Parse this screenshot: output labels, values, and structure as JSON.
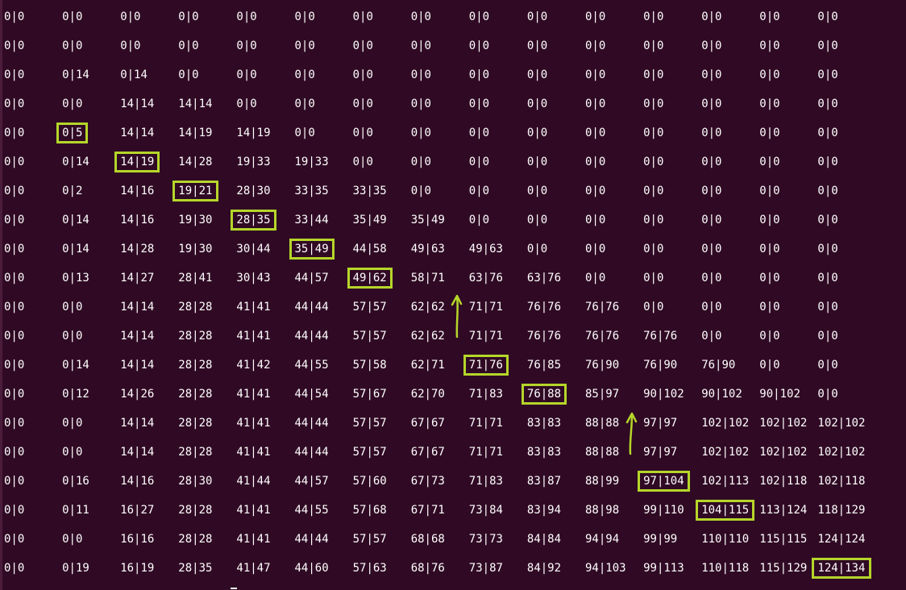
{
  "grid": {
    "rows": [
      [
        "0|0",
        "0|0",
        "0|0",
        "0|0",
        "0|0",
        "0|0",
        "0|0",
        "0|0",
        "0|0",
        "0|0",
        "0|0",
        "0|0",
        "0|0",
        "0|0",
        "0|0"
      ],
      [
        "0|0",
        "0|0",
        "0|0",
        "0|0",
        "0|0",
        "0|0",
        "0|0",
        "0|0",
        "0|0",
        "0|0",
        "0|0",
        "0|0",
        "0|0",
        "0|0",
        "0|0"
      ],
      [
        "0|0",
        "0|14",
        "0|14",
        "0|0",
        "0|0",
        "0|0",
        "0|0",
        "0|0",
        "0|0",
        "0|0",
        "0|0",
        "0|0",
        "0|0",
        "0|0",
        "0|0"
      ],
      [
        "0|0",
        "0|0",
        "14|14",
        "14|14",
        "0|0",
        "0|0",
        "0|0",
        "0|0",
        "0|0",
        "0|0",
        "0|0",
        "0|0",
        "0|0",
        "0|0",
        "0|0"
      ],
      [
        "0|0",
        "0|5",
        "14|14",
        "14|19",
        "14|19",
        "0|0",
        "0|0",
        "0|0",
        "0|0",
        "0|0",
        "0|0",
        "0|0",
        "0|0",
        "0|0",
        "0|0"
      ],
      [
        "0|0",
        "0|14",
        "14|19",
        "14|28",
        "19|33",
        "19|33",
        "0|0",
        "0|0",
        "0|0",
        "0|0",
        "0|0",
        "0|0",
        "0|0",
        "0|0",
        "0|0"
      ],
      [
        "0|0",
        "0|2",
        "14|16",
        "19|21",
        "28|30",
        "33|35",
        "33|35",
        "0|0",
        "0|0",
        "0|0",
        "0|0",
        "0|0",
        "0|0",
        "0|0",
        "0|0"
      ],
      [
        "0|0",
        "0|14",
        "14|16",
        "19|30",
        "28|35",
        "33|44",
        "35|49",
        "35|49",
        "0|0",
        "0|0",
        "0|0",
        "0|0",
        "0|0",
        "0|0",
        "0|0"
      ],
      [
        "0|0",
        "0|14",
        "14|28",
        "19|30",
        "30|44",
        "35|49",
        "44|58",
        "49|63",
        "49|63",
        "0|0",
        "0|0",
        "0|0",
        "0|0",
        "0|0",
        "0|0"
      ],
      [
        "0|0",
        "0|13",
        "14|27",
        "28|41",
        "30|43",
        "44|57",
        "49|62",
        "58|71",
        "63|76",
        "63|76",
        "0|0",
        "0|0",
        "0|0",
        "0|0",
        "0|0"
      ],
      [
        "0|0",
        "0|0",
        "14|14",
        "28|28",
        "41|41",
        "44|44",
        "57|57",
        "62|62",
        "71|71",
        "76|76",
        "76|76",
        "0|0",
        "0|0",
        "0|0",
        "0|0"
      ],
      [
        "0|0",
        "0|0",
        "14|14",
        "28|28",
        "41|41",
        "44|44",
        "57|57",
        "62|62",
        "71|71",
        "76|76",
        "76|76",
        "76|76",
        "0|0",
        "0|0",
        "0|0"
      ],
      [
        "0|0",
        "0|14",
        "14|14",
        "28|28",
        "41|42",
        "44|55",
        "57|58",
        "62|71",
        "71|76",
        "76|85",
        "76|90",
        "76|90",
        "76|90",
        "0|0",
        "0|0"
      ],
      [
        "0|0",
        "0|12",
        "14|26",
        "28|28",
        "41|41",
        "44|54",
        "57|67",
        "62|70",
        "71|83",
        "76|88",
        "85|97",
        "90|102",
        "90|102",
        "90|102",
        "0|0"
      ],
      [
        "0|0",
        "0|0",
        "14|14",
        "28|28",
        "41|41",
        "44|44",
        "57|57",
        "67|67",
        "71|71",
        "83|83",
        "88|88",
        "97|97",
        "102|102",
        "102|102",
        "102|102"
      ],
      [
        "0|0",
        "0|0",
        "14|14",
        "28|28",
        "41|41",
        "44|44",
        "57|57",
        "67|67",
        "71|71",
        "83|83",
        "88|88",
        "97|97",
        "102|102",
        "102|102",
        "102|102"
      ],
      [
        "0|0",
        "0|16",
        "14|16",
        "28|30",
        "41|44",
        "44|57",
        "57|60",
        "67|73",
        "71|83",
        "83|87",
        "88|99",
        "97|104",
        "102|113",
        "102|118",
        "102|118"
      ],
      [
        "0|0",
        "0|11",
        "16|27",
        "28|28",
        "41|41",
        "44|55",
        "57|68",
        "67|71",
        "73|84",
        "83|94",
        "88|98",
        "99|110",
        "104|115",
        "113|124",
        "118|129"
      ],
      [
        "0|0",
        "0|0",
        "16|16",
        "28|28",
        "41|41",
        "44|44",
        "57|57",
        "68|68",
        "73|73",
        "84|84",
        "94|94",
        "99|99",
        "110|110",
        "115|115",
        "124|124"
      ],
      [
        "0|0",
        "0|19",
        "16|19",
        "28|35",
        "41|47",
        "44|60",
        "57|63",
        "68|76",
        "73|87",
        "84|92",
        "94|103",
        "99|113",
        "110|118",
        "115|129",
        "124|134"
      ]
    ],
    "highlighted": [
      [
        4,
        1
      ],
      [
        5,
        2
      ],
      [
        6,
        3
      ],
      [
        7,
        4
      ],
      [
        8,
        5
      ],
      [
        9,
        6
      ],
      [
        12,
        8
      ],
      [
        13,
        9
      ],
      [
        16,
        11
      ],
      [
        17,
        12
      ],
      [
        19,
        14
      ]
    ]
  },
  "colors": {
    "background": "#300a24",
    "text": "#ffffff",
    "highlight": "#b5d62a"
  }
}
